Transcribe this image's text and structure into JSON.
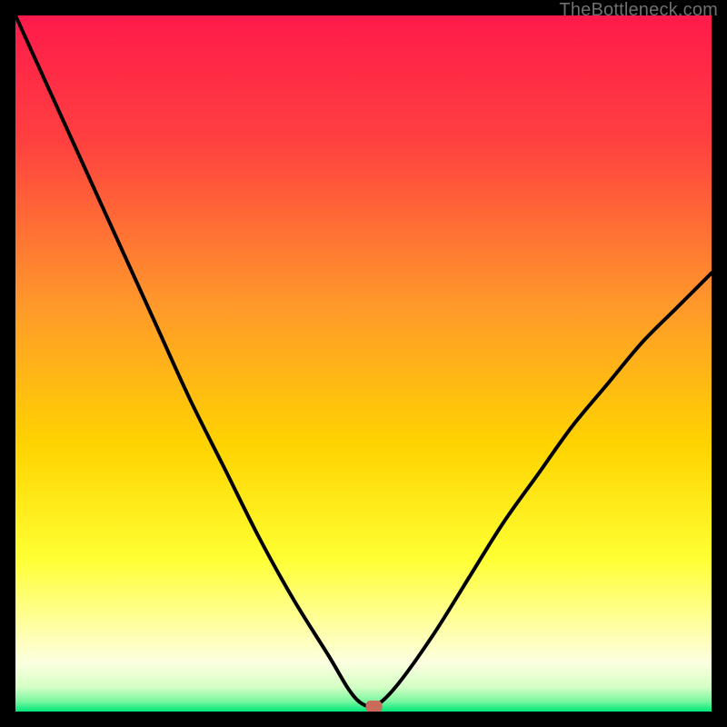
{
  "watermark": "TheBottleneck.com",
  "colors": {
    "gradient_top": "#ff1a4b",
    "gradient_mid1": "#ff7a2e",
    "gradient_mid2": "#ffd400",
    "gradient_mid3": "#ffff66",
    "gradient_mid4": "#fbffd6",
    "gradient_bottom": "#00e77a",
    "curve": "#000000",
    "marker": "#c96a5a",
    "frame": "#000000"
  },
  "chart_data": {
    "type": "line",
    "title": "",
    "xlabel": "",
    "ylabel": "",
    "xlim": [
      0,
      100
    ],
    "ylim": [
      0,
      100
    ],
    "series": [
      {
        "name": "bottleneck-curve",
        "x": [
          0,
          5,
          10,
          15,
          20,
          25,
          30,
          35,
          40,
          45,
          48,
          50,
          52,
          55,
          60,
          65,
          70,
          75,
          80,
          85,
          90,
          95,
          100
        ],
        "values": [
          100,
          89,
          78,
          67,
          56,
          45,
          35,
          25,
          16,
          8,
          3,
          1,
          1,
          4,
          11,
          19,
          27,
          34,
          41,
          47,
          53,
          58,
          63
        ]
      }
    ],
    "markers": [
      {
        "name": "optimal-point",
        "x": 51.5,
        "y": 0.8
      }
    ],
    "annotations": []
  }
}
